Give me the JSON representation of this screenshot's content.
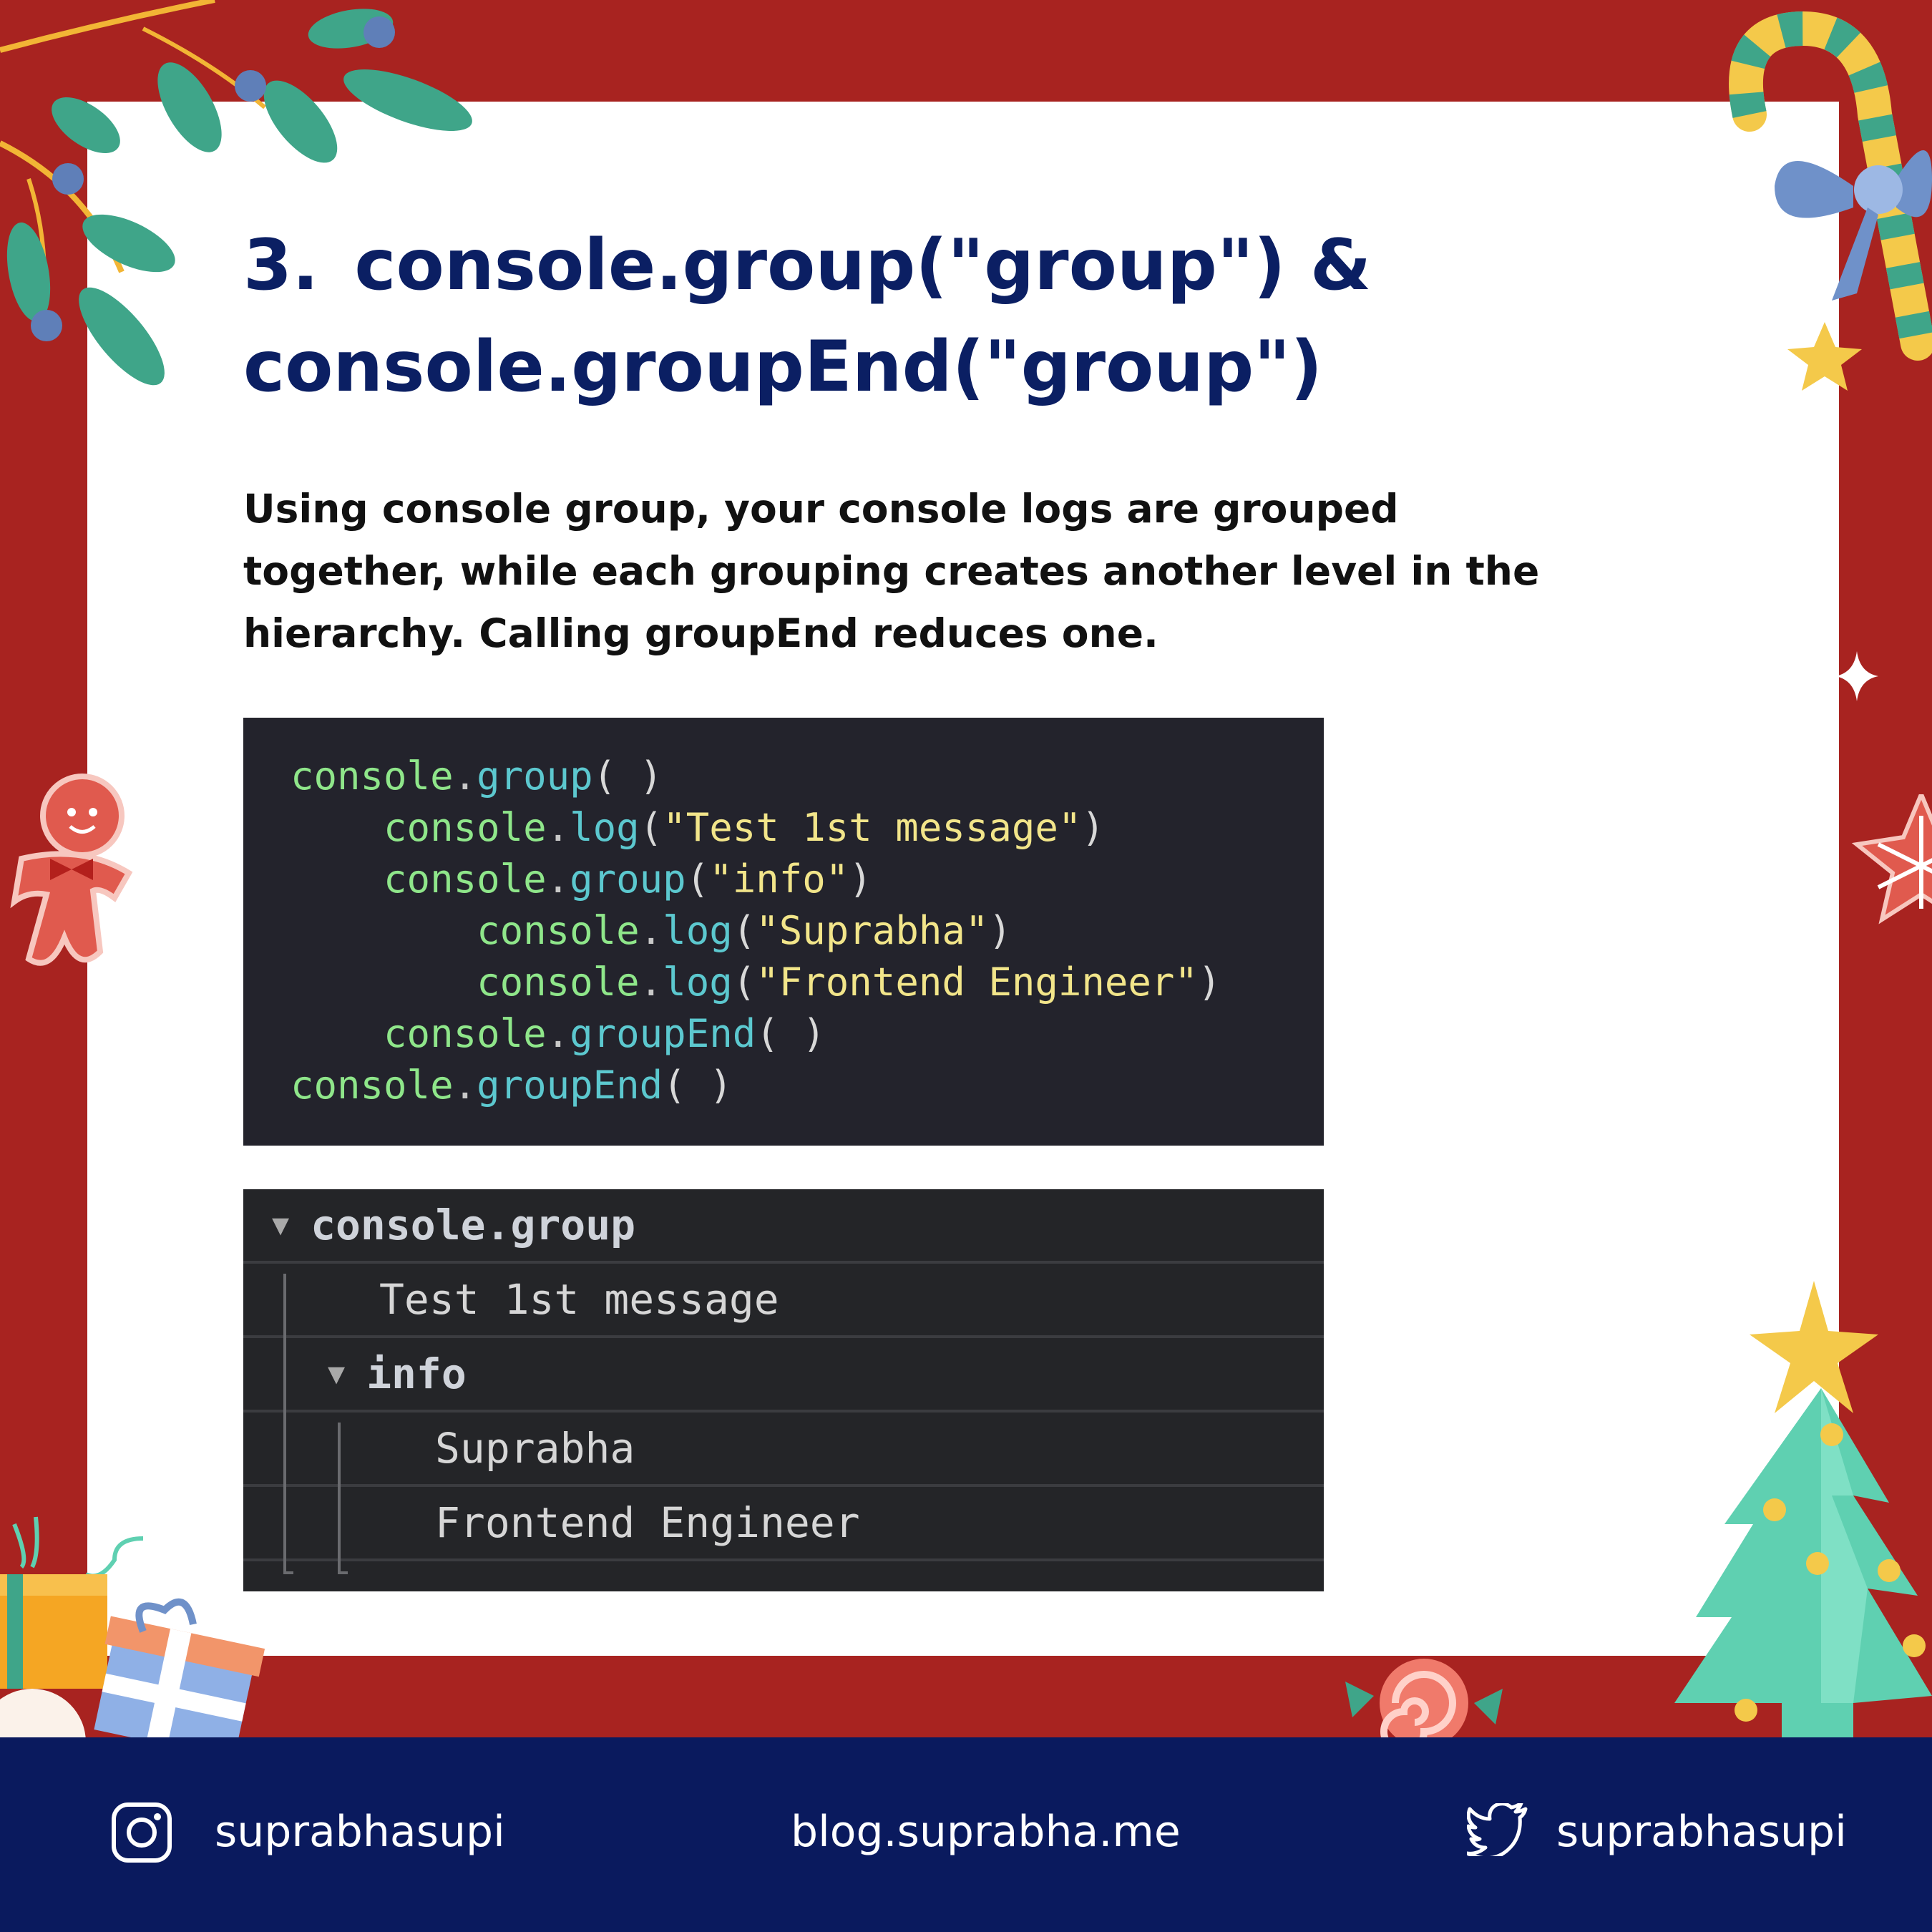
{
  "title": {
    "number": "3.",
    "line1": "console.group(\"group\") &",
    "line2": "console.groupEnd(\"group\")"
  },
  "description": "Using console group, your console logs are grouped together, while each grouping creates another level in the hierarchy. Calling groupEnd reduces one.",
  "code_lines": [
    [
      {
        "t": "console",
        "c": "c-obj"
      },
      {
        "t": ".",
        "c": "c-dot"
      },
      {
        "t": "group",
        "c": "c-fn"
      },
      {
        "t": "( )",
        "c": "c-pun"
      }
    ],
    [
      {
        "t": "    console",
        "c": "c-obj"
      },
      {
        "t": ".",
        "c": "c-dot"
      },
      {
        "t": "log",
        "c": "c-fn"
      },
      {
        "t": "(",
        "c": "c-pun"
      },
      {
        "t": "\"Test 1st message\"",
        "c": "c-str"
      },
      {
        "t": ")",
        "c": "c-pun"
      }
    ],
    [
      {
        "t": "    console",
        "c": "c-obj"
      },
      {
        "t": ".",
        "c": "c-dot"
      },
      {
        "t": "group",
        "c": "c-fn"
      },
      {
        "t": "(",
        "c": "c-pun"
      },
      {
        "t": "\"info\"",
        "c": "c-str"
      },
      {
        "t": ")",
        "c": "c-pun"
      }
    ],
    [
      {
        "t": "        console",
        "c": "c-obj"
      },
      {
        "t": ".",
        "c": "c-dot"
      },
      {
        "t": "log",
        "c": "c-fn"
      },
      {
        "t": "(",
        "c": "c-pun"
      },
      {
        "t": "\"Suprabha\"",
        "c": "c-str"
      },
      {
        "t": ")",
        "c": "c-pun"
      }
    ],
    [
      {
        "t": "        console",
        "c": "c-obj"
      },
      {
        "t": ".",
        "c": "c-dot"
      },
      {
        "t": "log",
        "c": "c-fn"
      },
      {
        "t": "(",
        "c": "c-pun"
      },
      {
        "t": "\"Frontend Engineer\"",
        "c": "c-str"
      },
      {
        "t": ")",
        "c": "c-pun"
      }
    ],
    [
      {
        "t": "    console",
        "c": "c-obj"
      },
      {
        "t": ".",
        "c": "c-dot"
      },
      {
        "t": "groupEnd",
        "c": "c-fn"
      },
      {
        "t": "( )",
        "c": "c-pun"
      }
    ],
    [
      {
        "t": "console",
        "c": "c-obj"
      },
      {
        "t": ".",
        "c": "c-dot"
      },
      {
        "t": "groupEnd",
        "c": "c-fn"
      },
      {
        "t": "( )",
        "c": "c-pun"
      }
    ]
  ],
  "console_output": {
    "group1": "console.group",
    "msg1": "Test 1st message",
    "group2": "info",
    "msg2": "Suprabha",
    "msg3": "Frontend Engineer",
    "expand_glyph": "▼"
  },
  "footer": {
    "instagram_handle": "suprabhasupi",
    "blog_url": "blog.suprabha.me",
    "twitter_handle": "suprabhasupi"
  },
  "colors": {
    "frame_red": "#a82320",
    "navy": "#0a1a5e",
    "title_blue": "#0b1f63",
    "code_bg": "#23232c",
    "console_bg": "#242528"
  }
}
